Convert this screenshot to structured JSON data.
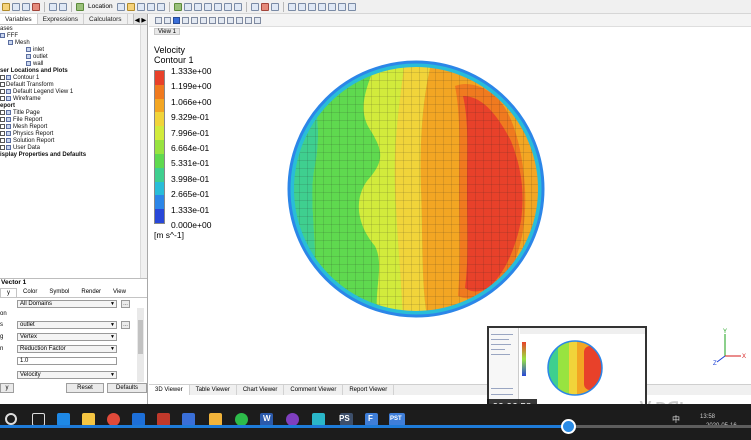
{
  "toolbar": {
    "location_label": "Location"
  },
  "left_panel": {
    "tabs": [
      "Variables",
      "Expressions",
      "Calculators"
    ],
    "tab_arrows": "◀ ▶",
    "tree": [
      {
        "label": "ases",
        "bold": false
      },
      {
        "label": "FFF",
        "bold": false
      },
      {
        "label": "Mesh",
        "bold": false
      },
      {
        "label": "inlet",
        "bold": false
      },
      {
        "label": "outlet",
        "bold": false
      },
      {
        "label": "wall",
        "bold": false
      },
      {
        "label": "ser Locations and Plots",
        "bold": true
      },
      {
        "label": "Contour 1",
        "bold": false
      },
      {
        "label": "Default Transform",
        "bold": false
      },
      {
        "label": "Default Legend View 1",
        "bold": false
      },
      {
        "label": "Wireframe",
        "bold": false
      },
      {
        "label": "eport",
        "bold": true
      },
      {
        "label": "Title Page",
        "bold": false
      },
      {
        "label": "File Report",
        "bold": false
      },
      {
        "label": "Mesh Report",
        "bold": false
      },
      {
        "label": "Physics Report",
        "bold": false
      },
      {
        "label": "Solution Report",
        "bold": false
      },
      {
        "label": "User Data",
        "bold": false
      },
      {
        "label": "isplay Properties and Defaults",
        "bold": true
      }
    ],
    "details": {
      "title": "Vector 1",
      "tabs": [
        "y",
        "Color",
        "Symbol",
        "Render",
        "View"
      ],
      "rows": [
        {
          "label": "",
          "value": "All Domains"
        },
        {
          "label": "on",
          "value": ""
        },
        {
          "label": "s",
          "value": "outlet"
        },
        {
          "label": "g",
          "value": "Vertex"
        },
        {
          "label": "n",
          "value": "Reduction Factor"
        },
        {
          "label": "",
          "value": "1.0"
        },
        {
          "label": "",
          "value": "Velocity"
        }
      ],
      "buttons": {
        "apply": "y",
        "reset": "Reset",
        "defaults": "Defaults"
      }
    }
  },
  "viewer": {
    "view_label": "View 1",
    "legend": {
      "variable": "Velocity",
      "plot_name": "Contour 1",
      "units": "[m s^-1]",
      "ticks": [
        "1.333e+00",
        "1.199e+00",
        "1.066e+00",
        "9.329e-01",
        "7.996e-01",
        "6.664e-01",
        "5.331e-01",
        "3.998e-01",
        "2.665e-01",
        "1.333e-01",
        "0.000e+00"
      ],
      "colors": [
        "#e8412a",
        "#f07a1f",
        "#f3a623",
        "#f1d43a",
        "#d2eb3c",
        "#98e340",
        "#5fd94f",
        "#3fcf8f",
        "#29bdd8",
        "#2c86e8",
        "#2847d8"
      ]
    },
    "tabs": [
      "3D Viewer",
      "Table Viewer",
      "Chart Viewer",
      "Comment Viewer",
      "Report Viewer"
    ]
  },
  "video": {
    "elapsed": "00:06:58",
    "progress": 0.757
  },
  "taskbar": {
    "app_labels": [
      "W",
      "PS",
      "F",
      "PST"
    ],
    "lang": "中",
    "time": "13:58",
    "date": "2020-05-16"
  }
}
